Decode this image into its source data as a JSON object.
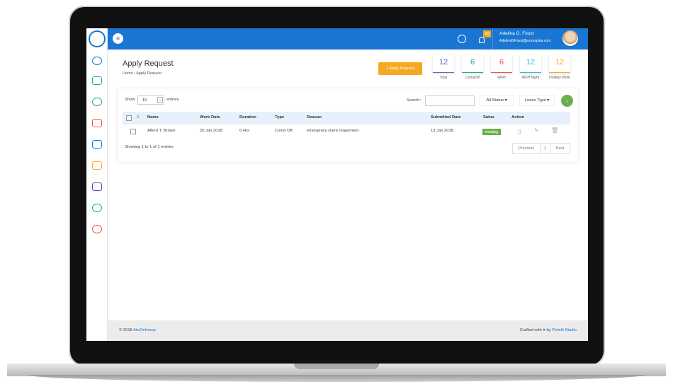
{
  "header": {
    "user_name": "Adelina G. Foust",
    "user_email": "AdelinaGFoust@journapide.com",
    "notification_count": "10"
  },
  "page": {
    "title": "Apply Request",
    "breadcrumb": [
      "Home",
      "Apply Request"
    ],
    "breadcrumb_sep": "›",
    "apply_button": "+ Apply Request"
  },
  "stats": [
    {
      "value": "12",
      "label": "Total",
      "color": "#5c6bc0"
    },
    {
      "value": "6",
      "label": "CompOff",
      "color": "#26a69a"
    },
    {
      "value": "6",
      "label": "WFH",
      "color": "#ef5350"
    },
    {
      "value": "12",
      "label": "WFH Night",
      "color": "#26c6da"
    },
    {
      "value": "12",
      "label": "Holiday Work",
      "color": "#ffa726"
    }
  ],
  "table": {
    "show_label": "Show",
    "entries_value": "10",
    "entries_label": "entries",
    "search_label": "Search:",
    "search_value": "",
    "status_filter": "All Status ▾",
    "leave_filter": "Leave Type ▾",
    "columns": [
      "Name",
      "Work Date",
      "Duration",
      "Type",
      "Reason",
      "Submitted Date",
      "Satus",
      "Action"
    ],
    "rows": [
      {
        "name": "Albert T. Brown",
        "work_date": "20 Jan 2018",
        "duration": "6 Hrs",
        "type": "Comp Off",
        "reason": "emergency client requriment",
        "submitted": "13 Jan 2018",
        "status": "Pending"
      }
    ],
    "info": "Showing 1 to 1 of 1 entries",
    "prev": "Previous",
    "page": "1",
    "next": "Next"
  },
  "footer": {
    "copyright": "© 2018",
    "company": "AtoZinfoway",
    "crafted": "Crafted with",
    "by": "by",
    "studio": "Pixlelit Studio"
  }
}
